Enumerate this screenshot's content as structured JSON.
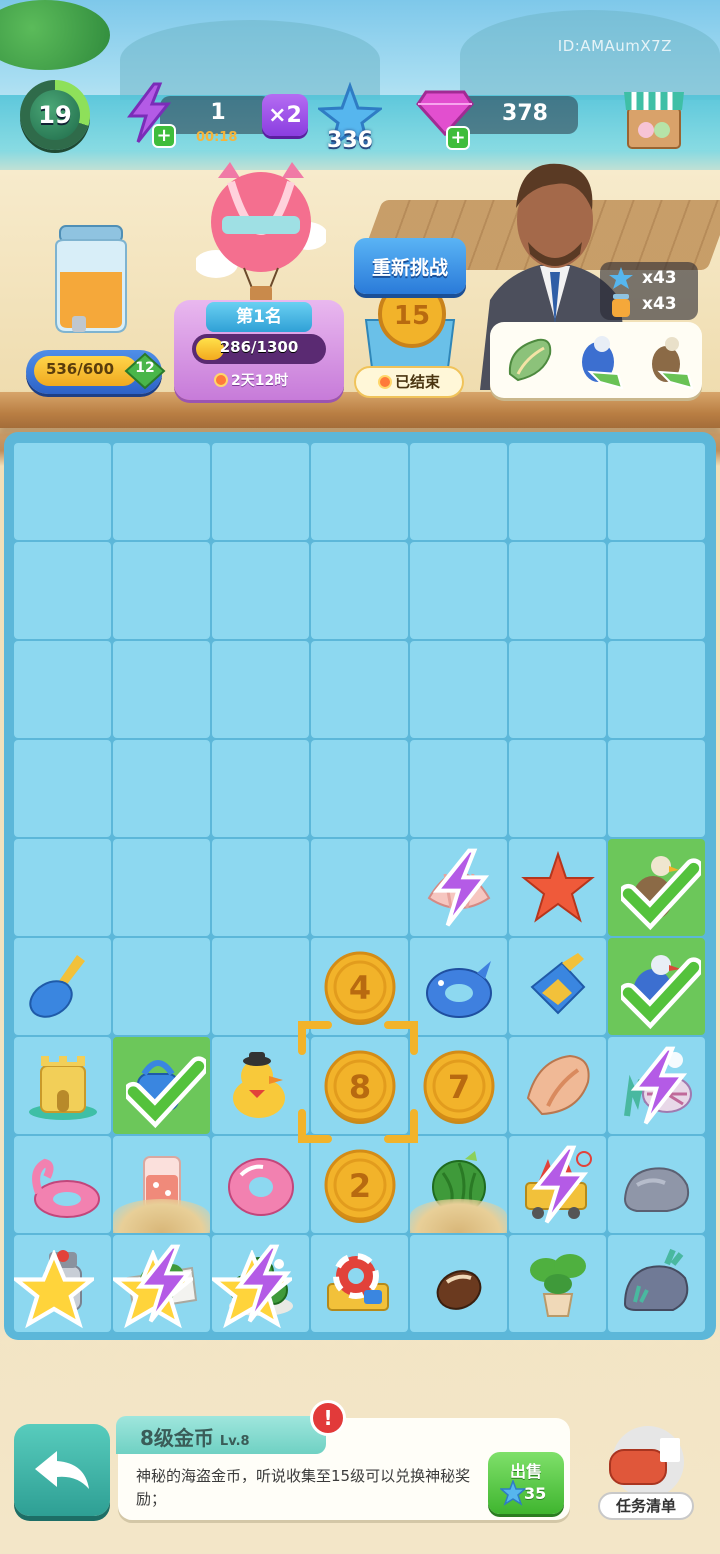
{
  "header": {
    "user_id": "ID:AMAumX7Z",
    "level": "19",
    "energy": {
      "value": "1",
      "timer": "00:18",
      "multiplier": "×2"
    },
    "stars": "336",
    "gems": "378"
  },
  "jar": {
    "progress": "536/600",
    "level": "12"
  },
  "event": {
    "rank": "第1名",
    "progress": "286/1300",
    "progress_fraction": 0.22,
    "time_left": "2天12时"
  },
  "challenge": {
    "retry_label": "重新挑战",
    "coin_number": "15",
    "status": "已结束"
  },
  "rewards": {
    "stars": "x43",
    "jars": "x43"
  },
  "board": {
    "rows": [
      [
        "",
        "",
        "",
        "",
        "",
        "",
        ""
      ],
      [
        "",
        "",
        "",
        "",
        "",
        "",
        ""
      ],
      [
        "",
        "",
        "",
        "",
        "",
        "",
        ""
      ],
      [
        "",
        "",
        "",
        "",
        "",
        "",
        ""
      ],
      [
        "",
        "",
        "",
        "",
        "shell",
        "starfish",
        "seagull-done"
      ],
      [
        "shovel",
        "",
        "",
        "coin-4",
        "float-ring",
        "scoop",
        "pigeon-done"
      ],
      [
        "sandcastle",
        "watering-can-done",
        "duck",
        "coin-8",
        "coin-7",
        "conch",
        "coral"
      ],
      [
        "flamingo",
        "juice",
        "donut-ring",
        "coin-2",
        "watermelon",
        "surf-cart",
        "rock"
      ],
      [
        "grill",
        "melon-cart",
        "melon-pile",
        "lifebuoy-cart",
        "seed",
        "plant",
        "rock-coral"
      ]
    ],
    "coin_labels": {
      "c4": "4",
      "c8": "8",
      "c7": "7",
      "c2": "2"
    }
  },
  "item_info": {
    "title": "8级金币",
    "level": "Lv.8",
    "description": "神秘的海盗金币，听说收集至15级可以兑换神秘奖励；",
    "sell_label": "出售",
    "sell_price": "35"
  },
  "task_list_label": "任务清单",
  "colors": {
    "board": "#5cb7d9",
    "cell": "#8dd8f0",
    "done_cell": "#6cc75a",
    "coin": "#f2b32a"
  }
}
